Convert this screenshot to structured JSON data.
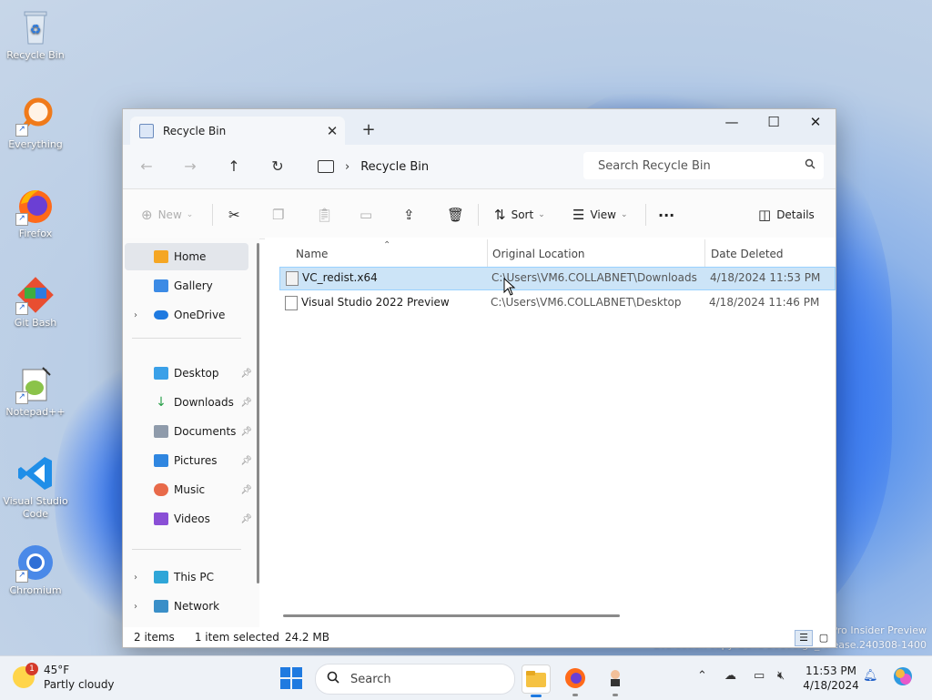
{
  "desktop": {
    "icons": [
      {
        "label": "Recycle Bin",
        "icon": "recycle-bin-icon"
      },
      {
        "label": "Everything",
        "icon": "magnifier-icon"
      },
      {
        "label": "Firefox",
        "icon": "firefox-icon"
      },
      {
        "label": "Git Bash",
        "icon": "git-icon"
      },
      {
        "label": "Notepad++",
        "icon": "notepad-plus-plus-icon"
      },
      {
        "label": "Visual Studio Code",
        "icon": "vscode-icon"
      },
      {
        "label": "Chromium",
        "icon": "chromium-icon"
      }
    ],
    "watermark": {
      "line1": "Pro Insider Preview",
      "line2": "Evaluation copy. Build 26100.ge_release.240308-1400"
    }
  },
  "window": {
    "tab_title": "Recycle Bin",
    "tab_close": "✕",
    "new_tab": "+",
    "controls": {
      "minimize": "—",
      "maximize": "☐",
      "close": "✕"
    },
    "breadcrumb": {
      "separator": "›",
      "location": "Recycle Bin"
    },
    "search_placeholder": "Search Recycle Bin",
    "toolbar": {
      "new": "New",
      "sort": "Sort",
      "view": "View",
      "more": "···",
      "details": "Details"
    },
    "nav": {
      "home": "Home",
      "gallery": "Gallery",
      "onedrive": "OneDrive",
      "desktop": "Desktop",
      "downloads": "Downloads",
      "documents": "Documents",
      "pictures": "Pictures",
      "music": "Music",
      "videos": "Videos",
      "thispc": "This PC",
      "network": "Network"
    },
    "columns": {
      "name": "Name",
      "location": "Original Location",
      "deleted": "Date Deleted"
    },
    "files": [
      {
        "name": "VC_redist.x64",
        "location": "C:\\Users\\VM6.COLLABNET\\Downloads",
        "deleted": "4/18/2024 11:53 PM",
        "selected": true
      },
      {
        "name": "Visual Studio 2022 Preview",
        "location": "C:\\Users\\VM6.COLLABNET\\Desktop",
        "deleted": "4/18/2024 11:46 PM",
        "selected": false
      }
    ],
    "status": {
      "count": "2 items",
      "selection": "1 item selected",
      "size": "24.2 MB"
    }
  },
  "taskbar": {
    "weather": {
      "temp": "45°F",
      "desc": "Partly cloudy",
      "badge": "1"
    },
    "search_label": "Search",
    "clock": {
      "time": "11:53 PM",
      "date": "4/18/2024"
    }
  }
}
